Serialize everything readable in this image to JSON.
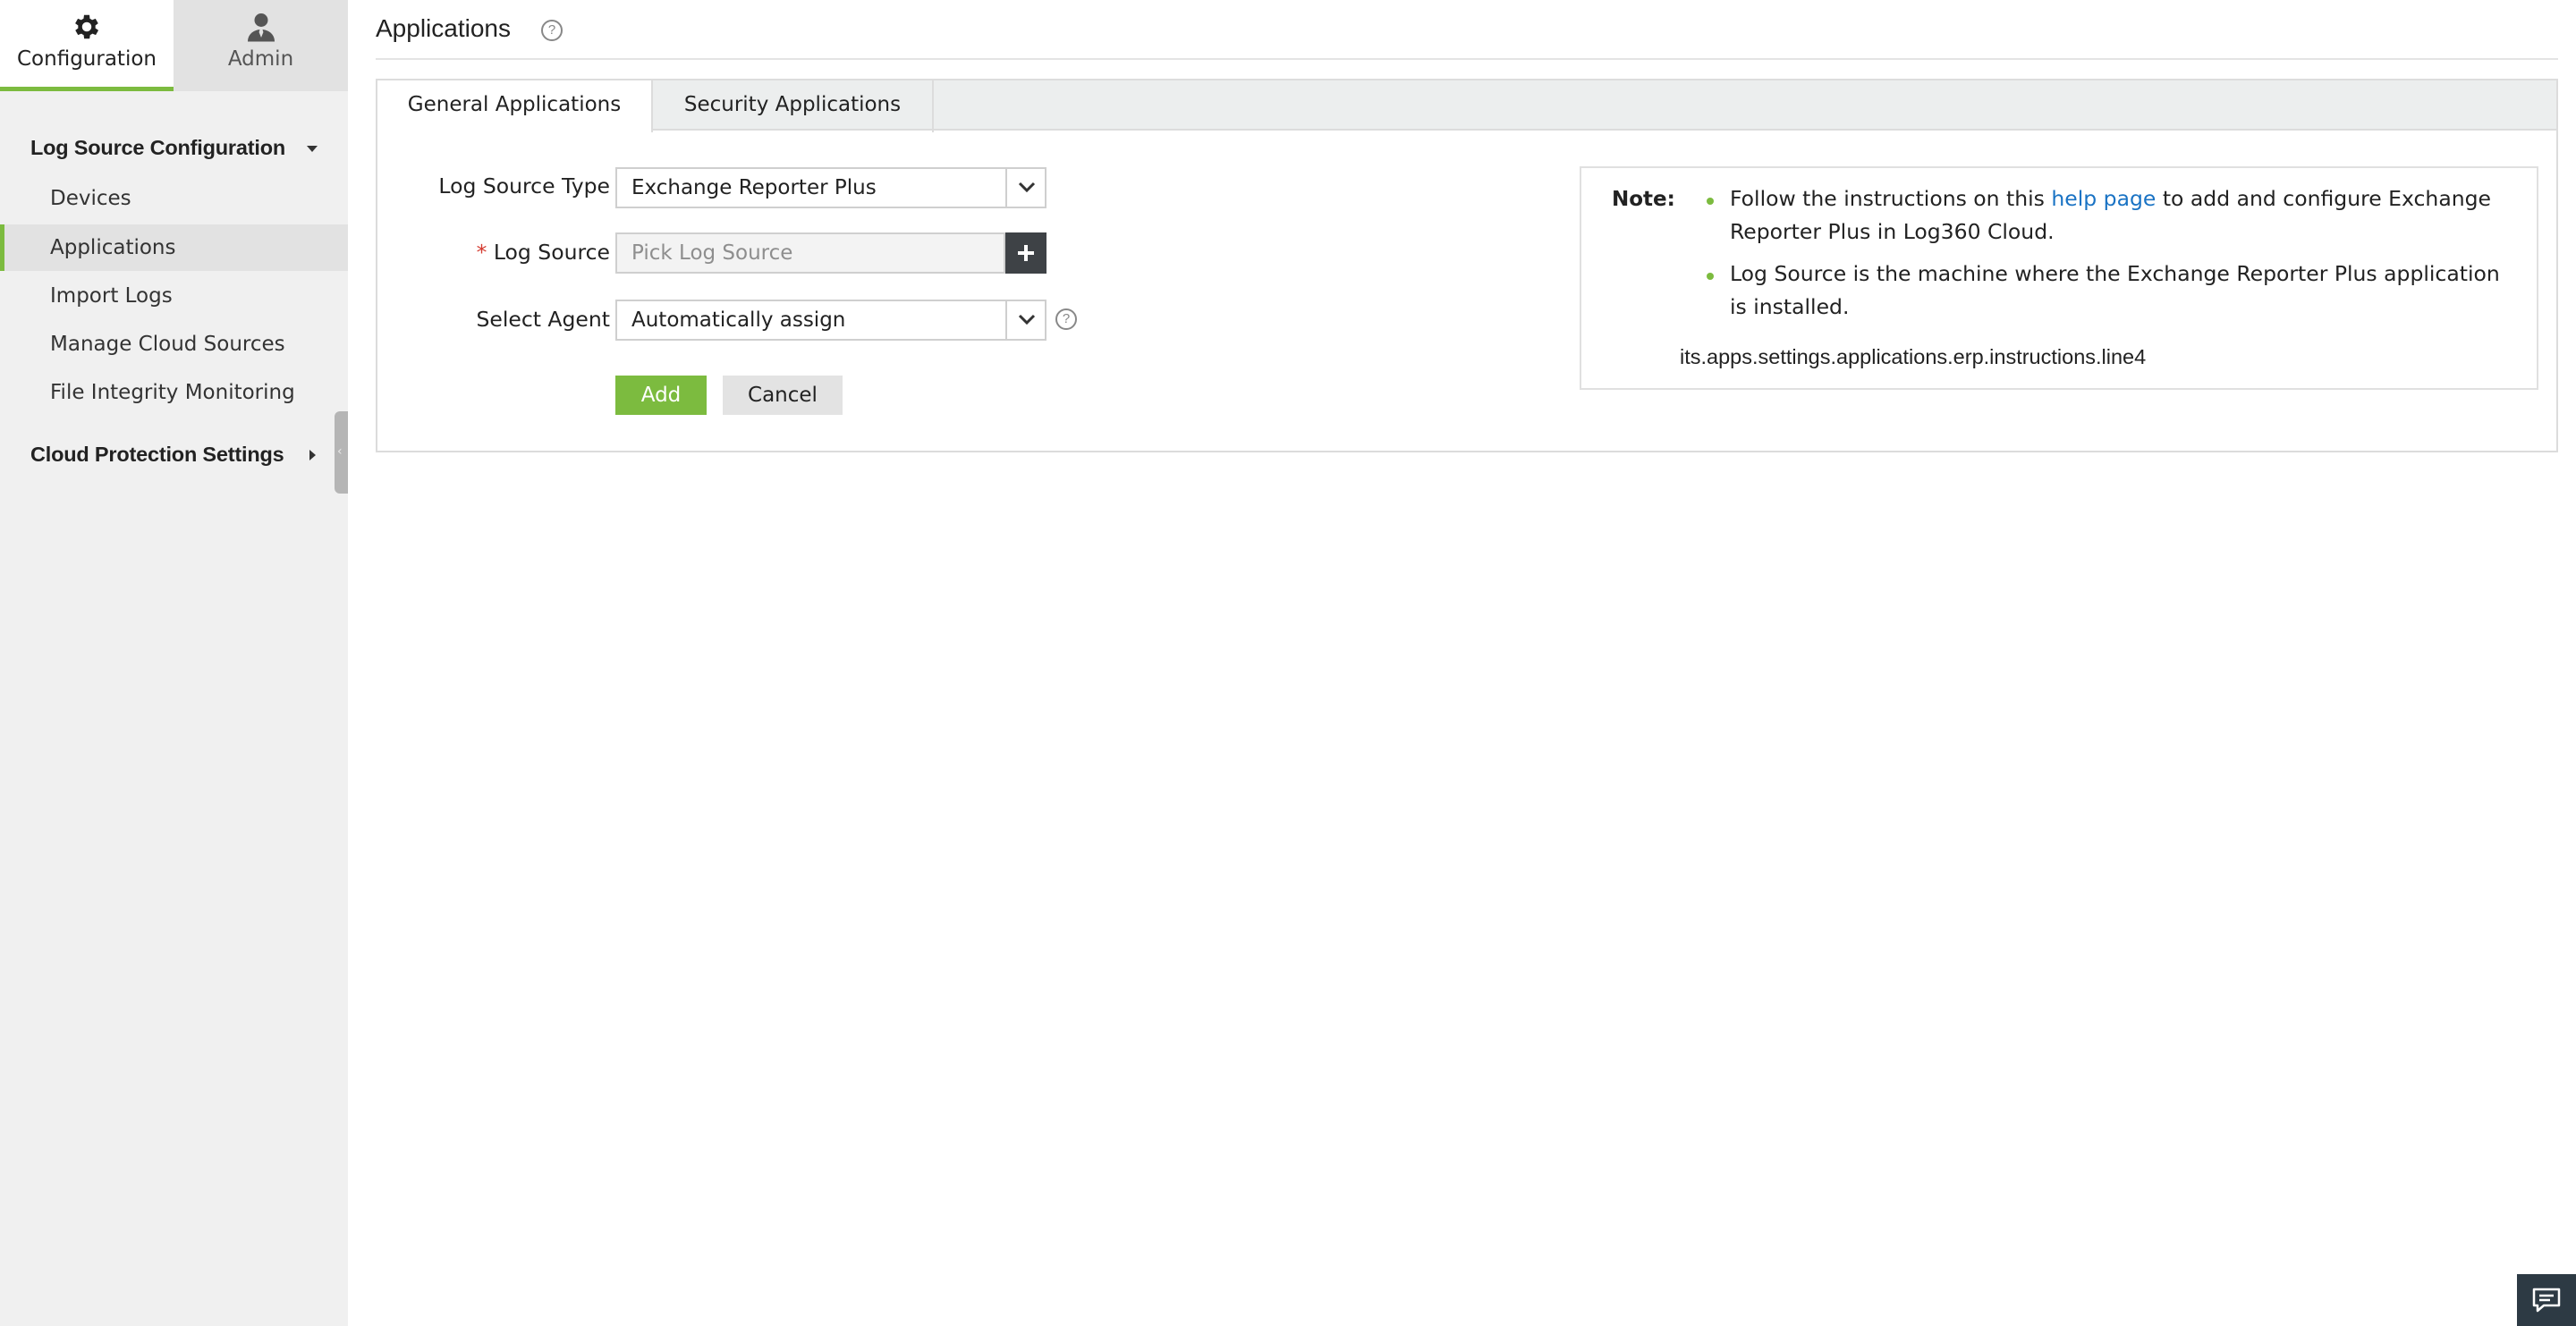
{
  "sidebar": {
    "tabs": [
      {
        "label": "Configuration",
        "icon": "gear-icon",
        "active": true
      },
      {
        "label": "Admin",
        "icon": "user-icon",
        "active": false
      }
    ],
    "section_config": "Log Source Configuration",
    "items": [
      {
        "label": "Devices"
      },
      {
        "label": "Applications"
      },
      {
        "label": "Import Logs"
      },
      {
        "label": "Manage Cloud Sources"
      },
      {
        "label": "File Integrity Monitoring"
      }
    ],
    "section_cloud": "Cloud Protection Settings",
    "collapse_glyph": "‹"
  },
  "page": {
    "title": "Applications",
    "help_glyph": "?"
  },
  "tabs": [
    {
      "label": "General Applications",
      "active": true
    },
    {
      "label": "Security Applications",
      "active": false
    }
  ],
  "form": {
    "log_source_type_label": "Log Source Type",
    "log_source_type_value": "Exchange Reporter Plus",
    "required_mark": "*",
    "log_source_label": "Log Source",
    "log_source_placeholder": "Pick Log Source",
    "select_agent_label": "Select Agent",
    "select_agent_value": "Automatically assign",
    "add_label": "Add",
    "cancel_label": "Cancel"
  },
  "note": {
    "label": "Note:",
    "line1_prefix": "Follow the instructions on this ",
    "line1_link": "help page",
    "line1_suffix": " to add and configure Exchange Reporter Plus in Log360 Cloud.",
    "line2": "Log Source is the machine where the Exchange Reporter Plus application is installed.",
    "line3": "its.apps.settings.applications.erp.instructions.line4"
  },
  "colors": {
    "accent_green": "#7cbb3f",
    "link_blue": "#1a73c4",
    "required_red": "#d43a2f"
  }
}
